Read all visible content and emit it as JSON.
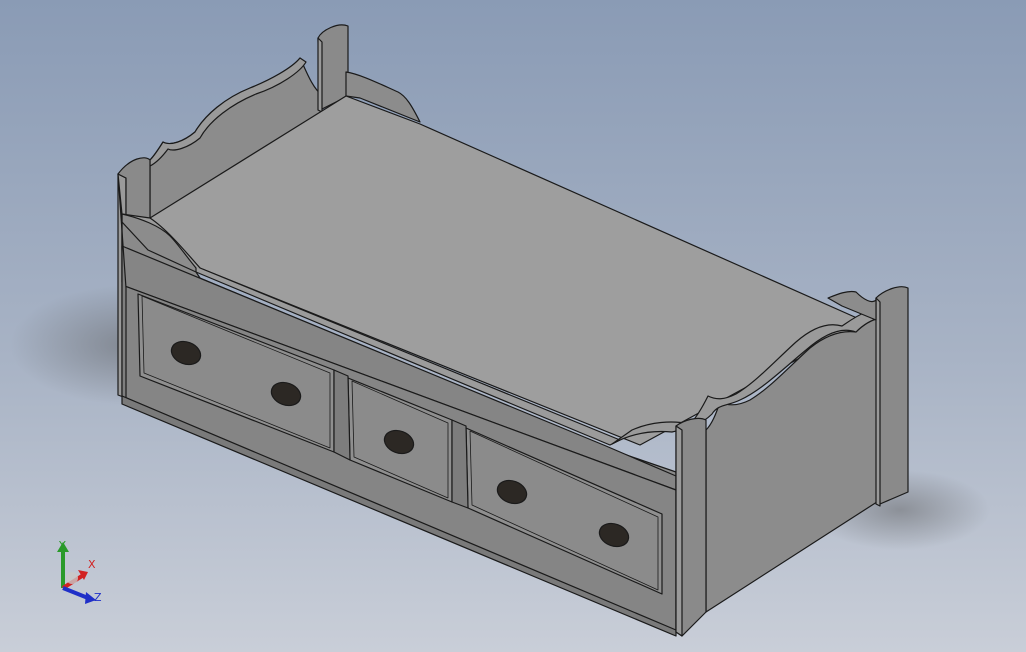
{
  "viewport": {
    "background_top": "#8c9db6",
    "background_bottom": "#c7ccd6"
  },
  "model": {
    "part_color": "#8c8c8c",
    "top_color": "#9e9e9e",
    "face_light": "#8f8f8f",
    "face_dark": "#7d7d7d",
    "edge_color": "#1a1a1a",
    "handle_color": "#2c2824"
  },
  "triad": {
    "y_label": "Y",
    "x_label": "X",
    "z_label": "Z",
    "y_color": "#2a9a2a",
    "x_color": "#d22222",
    "z_color": "#1f2fc8"
  }
}
